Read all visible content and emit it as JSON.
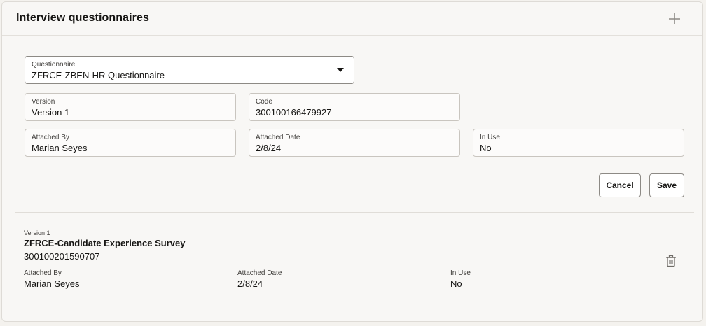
{
  "header": {
    "title": "Interview questionnaires",
    "add_icon": "plus-icon"
  },
  "form": {
    "questionnaire": {
      "label": "Questionnaire",
      "value": "ZFRCE-ZBEN-HR Questionnaire"
    },
    "version": {
      "label": "Version",
      "value": "Version 1"
    },
    "code": {
      "label": "Code",
      "value": "300100166479927"
    },
    "attached_by": {
      "label": "Attached By",
      "value": "Marian Seyes"
    },
    "attached_date": {
      "label": "Attached Date",
      "value": "2/8/24"
    },
    "in_use": {
      "label": "In Use",
      "value": "No"
    },
    "buttons": {
      "cancel": "Cancel",
      "save": "Save"
    }
  },
  "list": {
    "items": [
      {
        "version": "Version 1",
        "title": "ZFRCE-Candidate Experience Survey",
        "code": "300100201590707",
        "attached_by_label": "Attached By",
        "attached_by": "Marian Seyes",
        "attached_date_label": "Attached Date",
        "attached_date": "2/8/24",
        "in_use_label": "In Use",
        "in_use": "No",
        "delete_icon": "trash-icon"
      }
    ]
  },
  "colors": {
    "background": "#f4f2ee",
    "panel": "#f8f7f5",
    "text": "#161513",
    "border": "#c9c5bf"
  }
}
